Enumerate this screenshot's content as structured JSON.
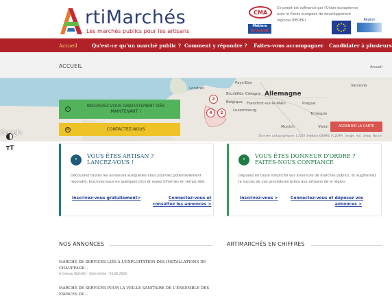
{
  "header": {
    "logo_letter": "A",
    "logo_text": "rtiMarchés",
    "logo_subtitle": "Les marchés publics pour les artisans",
    "cma_abbrev": "CMA",
    "cma_metiers_line1": "Métiers",
    "cma_metiers_line2": "Artisanat",
    "eu_text": "Ce projet est cofinancé par l'Union européenne avec le Fonds européen de développement régional (FEDER)",
    "region_label": "Région"
  },
  "nav": {
    "items": [
      {
        "label": "Accueil",
        "active": true
      },
      {
        "label": "Qu'est-ce qu'un marché public ?",
        "active": false
      },
      {
        "label": "Comment y répondre ?",
        "active": false
      },
      {
        "label": "Faites-vous accompagner",
        "active": false
      },
      {
        "label": "Candidater à plusieurs",
        "active": false
      }
    ]
  },
  "page": {
    "title": "ACCUEIL",
    "breadcrumb": "Accueil"
  },
  "map": {
    "labels": {
      "londres": "Londres",
      "pays_bas": "Pays-Bas",
      "bruxelles": "Bruxelles",
      "cologne": "Cologne",
      "allemagne": "Allemagne",
      "belgique": "Belgique",
      "francfort": "Francfort-sur-le-Main",
      "prague": "Prague",
      "luxembourg": "Luxembourg",
      "tcheque": "Tchéquie",
      "varsovie": "Varsovie",
      "munich": "Munich",
      "vienne": "Vienn"
    },
    "markers": [
      "2",
      "4",
      "2"
    ],
    "google": "Google",
    "credits": "Données cartographiques ©2020 GeoBasis-DE/BKG (©2009), Google, Inst. Geogr. Nacion",
    "enlarge_label": "AGRANDIR LA CARTE",
    "cta_register": "INSCRIVEZ-VOUS GRATUITEMENT DÈS MAINTENANT !",
    "cta_contact": "CONTACTEZ-NOUS",
    "accent_green": "#52b35c",
    "accent_yellow": "#eec328"
  },
  "accessibility": {
    "text_size_label": "тT"
  },
  "box_artisan": {
    "title_line1": "VOUS ÊTES ARTISAN ?",
    "title_line2": "LANCEZ-VOUS !",
    "text": "Découvrez toutes les annonces auxquelles vous pourriez potentiellement répondre. Inscrivez-vous en quelques clics et soyez informés en temps réel.",
    "link1": "Inscrivez-vous gratuitement>",
    "link2_line1": "Connectez-vous et",
    "link2_line2": "consultez les annonces >"
  },
  "box_donneur": {
    "title_line1": "VOUS ÊTES DONNEUR D'ORDRE ?",
    "title_line2": "FAITES-NOUS CONFIANCE",
    "text": "Déposez en toute simplicité vos annonces de marchés publics, et augmentez le succès de vos procédures grâce aux artisans de la région.",
    "link1": "Inscrivez-vous >",
    "link2_line1": "Connectez-vous et déposez vos",
    "link2_line2": "annonces >"
  },
  "sections": {
    "annonces_title": "NOS ANNONCES",
    "chiffres_title": "ARTIMARCHÉS EN CHIFFRES"
  },
  "annonces": [
    {
      "title": "MARCHÉ DE SERVICES LIÉS À L'EXPLOITATION DES INSTALLATIONS DE CHAUFFAGE...",
      "meta": "À Creney (62100) - Date limite : 03.06.2020"
    },
    {
      "title": "MARCHÉ DE SERVICES POUR LA VEILLE SANITAIRE DE L'ENSEMBLE DES ESPACES DU...",
      "meta": ""
    }
  ]
}
